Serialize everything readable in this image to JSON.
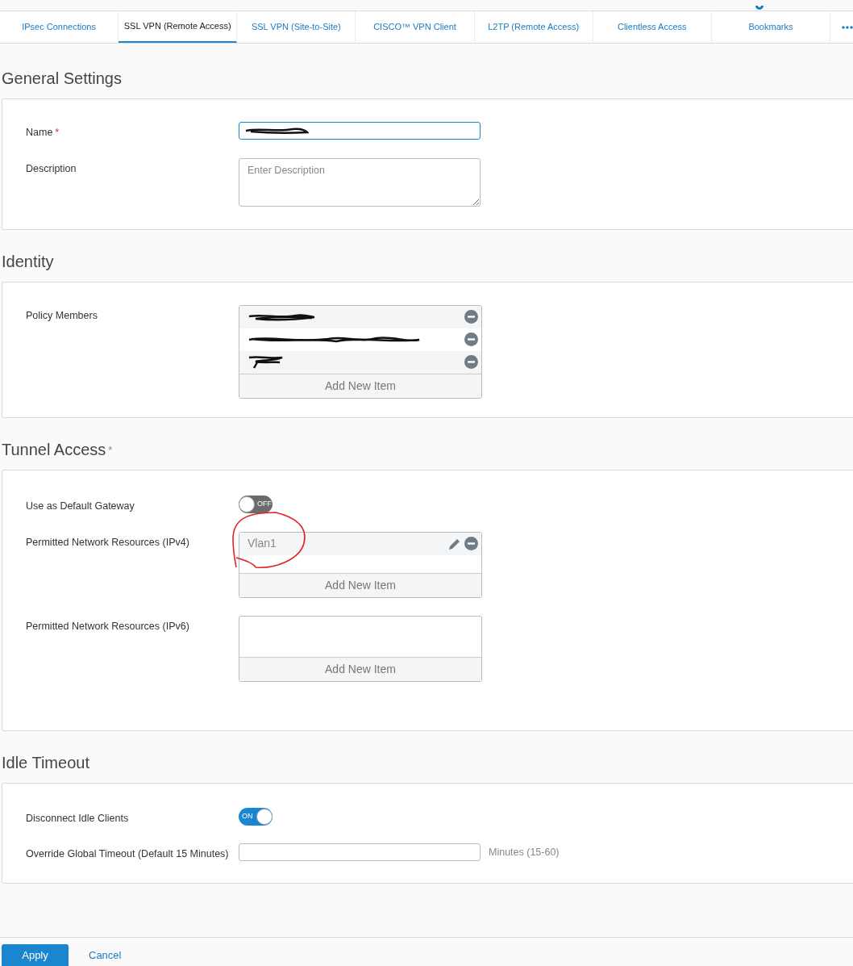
{
  "tabs": [
    {
      "label": "IPsec Connections",
      "selected": false
    },
    {
      "label": "SSL VPN (Remote Access)",
      "selected": true
    },
    {
      "label": "SSL VPN (Site-to-Site)",
      "selected": false
    },
    {
      "label": "CISCO™ VPN Client",
      "selected": false
    },
    {
      "label": "L2TP (Remote Access)",
      "selected": false
    },
    {
      "label": "Clientless Access",
      "selected": false
    },
    {
      "label": "Bookmarks",
      "selected": false
    }
  ],
  "sections": [
    {
      "title": "General Settings",
      "fields": [
        {
          "kind": "text",
          "label": "Name",
          "required_mark": "*",
          "redacted": true,
          "focused": true
        },
        {
          "kind": "textarea",
          "label": "Description",
          "placeholder": "Enter Description"
        }
      ]
    },
    {
      "title": "Identity",
      "fields": [
        {
          "kind": "list",
          "label": "Policy Members",
          "circled": false,
          "add_label": "Add New Item",
          "items": [
            {
              "redacted": true,
              "editable": false
            },
            {
              "redacted": true,
              "editable": false
            },
            {
              "redacted": true,
              "editable": false
            }
          ]
        }
      ]
    },
    {
      "title": "Tunnel Access",
      "required_mark": "*",
      "fields": [
        {
          "kind": "toggle",
          "label": "Use as Default Gateway",
          "on": false,
          "state_text": "OFF"
        },
        {
          "kind": "list",
          "label": "Permitted Network Resources (IPv4)",
          "circled": true,
          "add_label": "Add New Item",
          "items": [
            {
              "label": "Vlan1",
              "redacted": false,
              "editable": true
            }
          ]
        },
        {
          "kind": "list",
          "label": "Permitted Network Resources (IPv6)",
          "circled": false,
          "add_label": "Add New Item"
        }
      ]
    },
    {
      "title": "Idle Timeout",
      "fields": [
        {
          "kind": "toggle",
          "label": "Disconnect Idle Clients",
          "on": true,
          "state_text": "ON"
        },
        {
          "kind": "text",
          "label": "Override Global Timeout (Default 15 Minutes)",
          "redacted": false,
          "focused": false,
          "suffix": "Minutes (15-60)"
        }
      ]
    }
  ],
  "footer": {
    "primary": "Apply",
    "secondary": "Cancel"
  }
}
